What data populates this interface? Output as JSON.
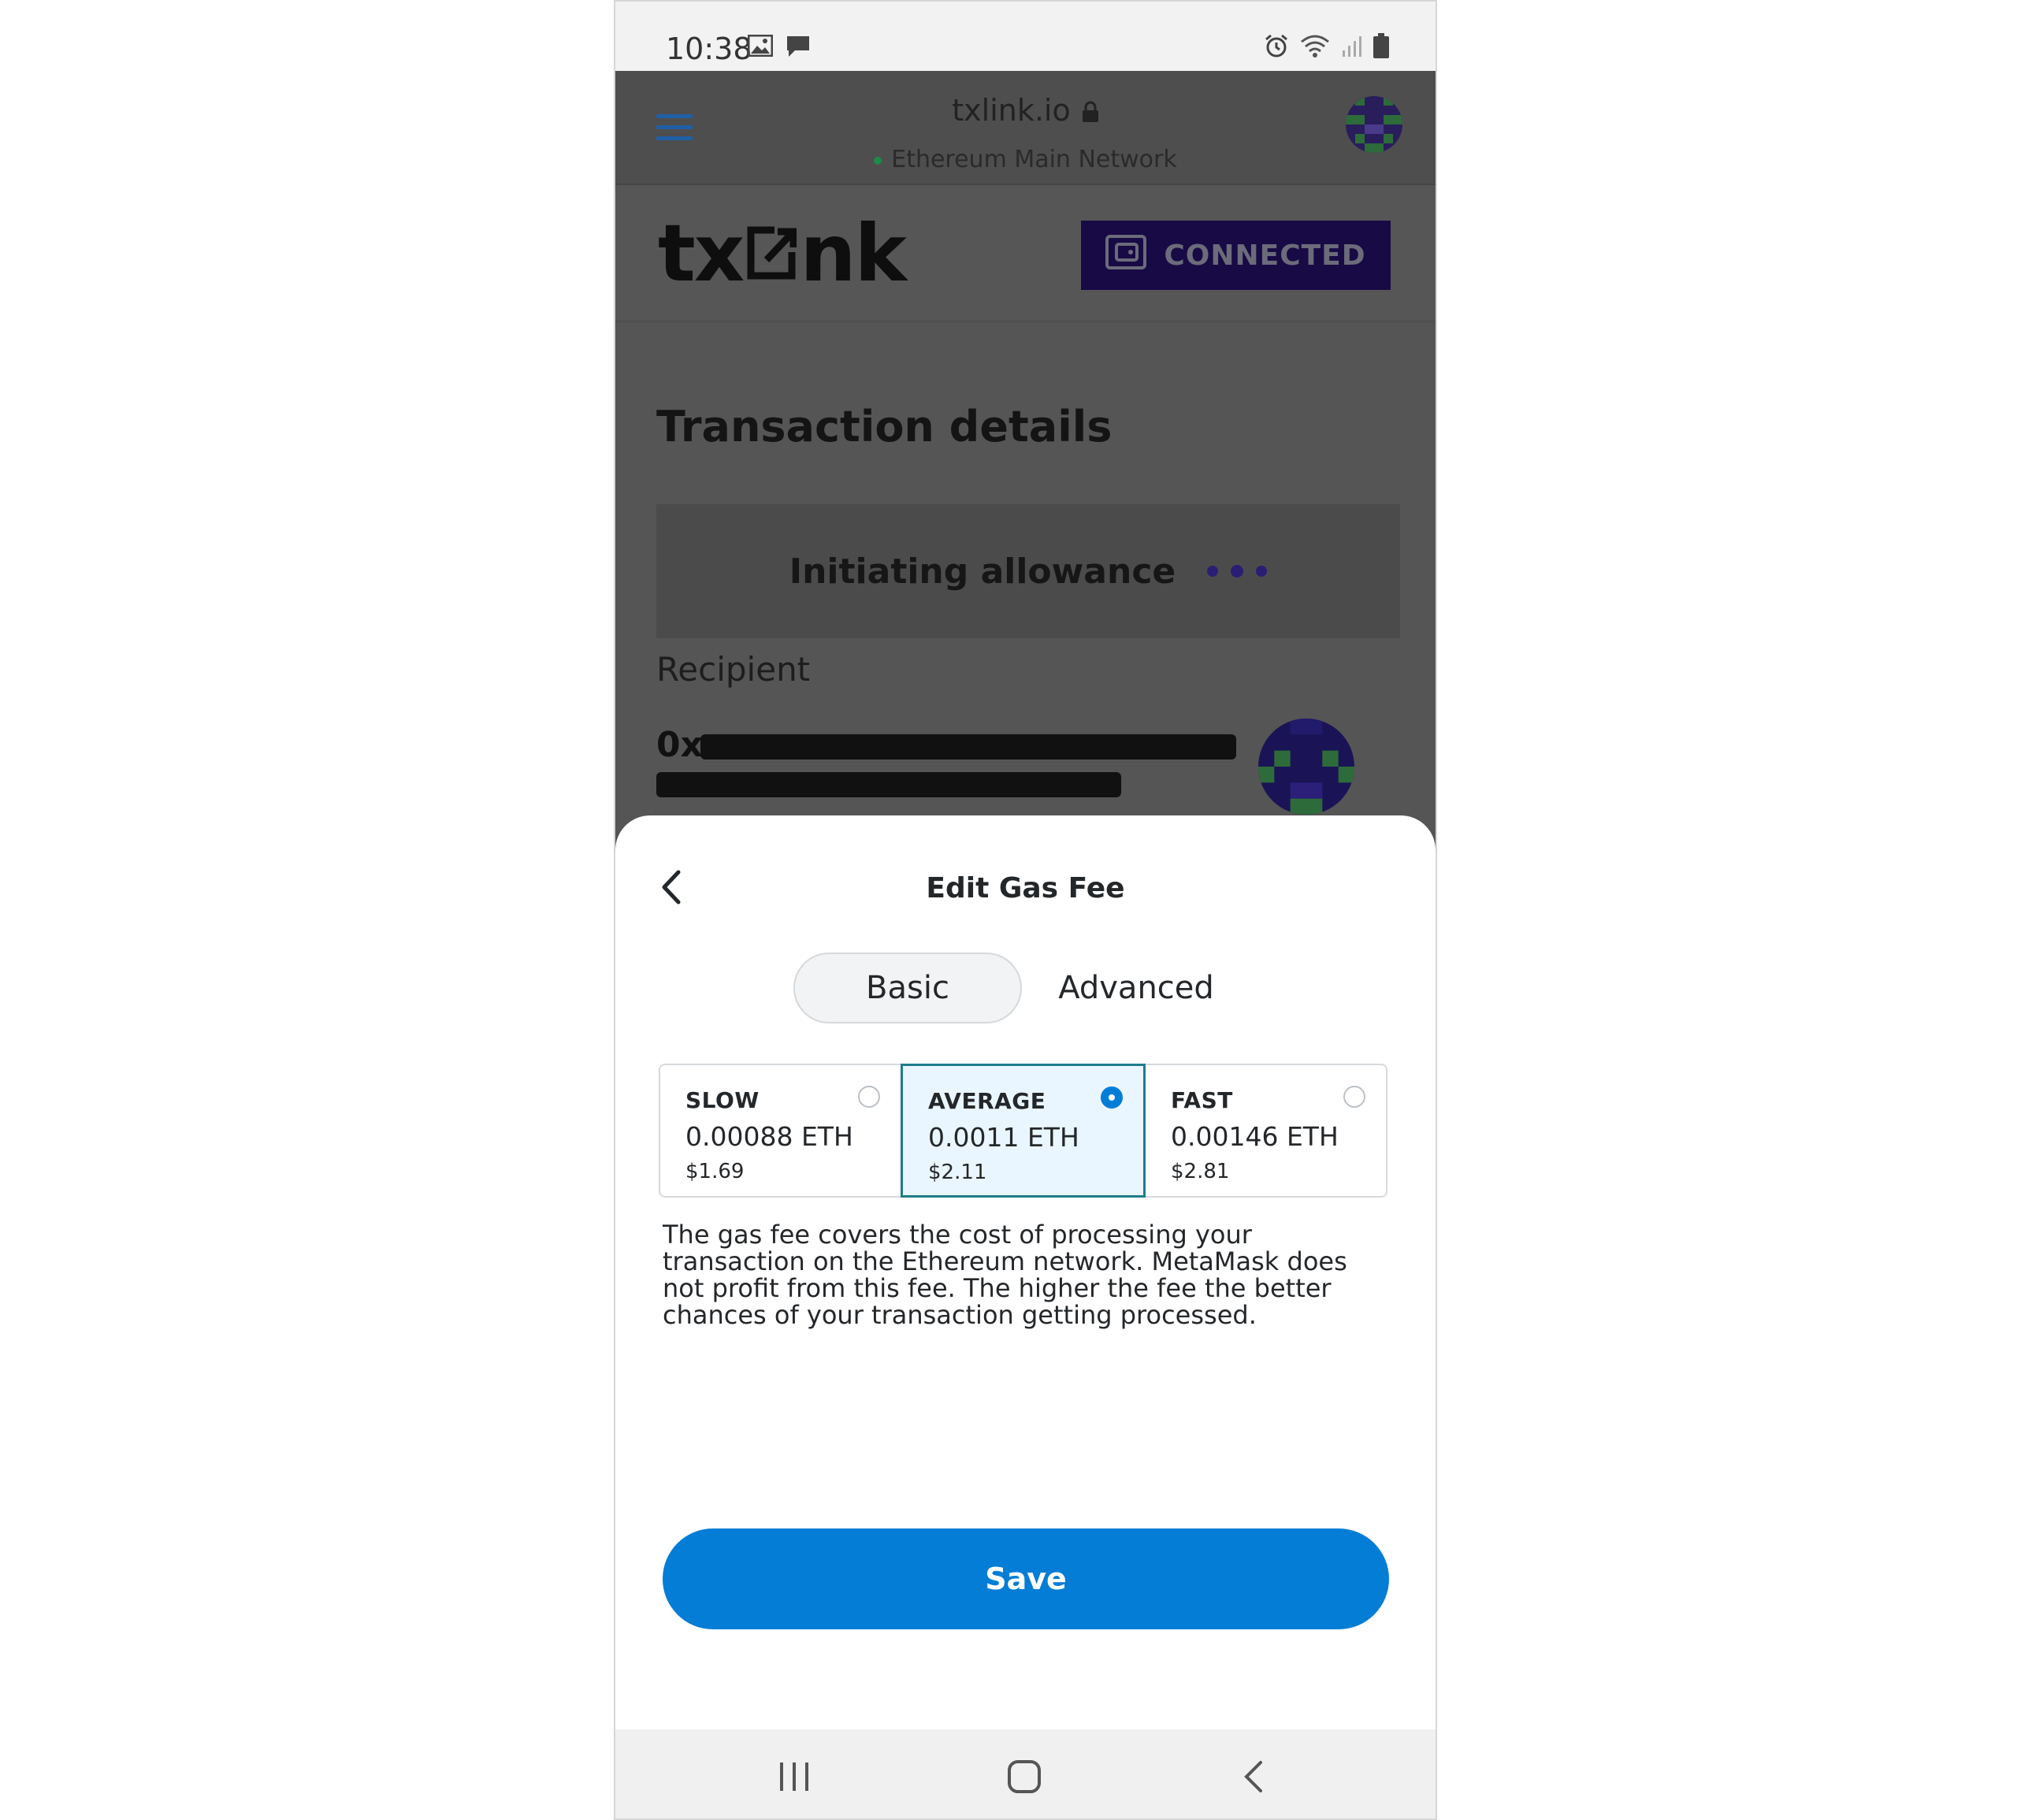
{
  "status_bar": {
    "time": "10:38",
    "left_icons": [
      "image-icon",
      "message-icon"
    ],
    "right_icons": [
      "alarm-icon",
      "wifi-icon",
      "signal-icon",
      "battery-icon"
    ]
  },
  "browser": {
    "url": "txlink.io",
    "network": "Ethereum Main Network",
    "network_dot_color": "#1e8a4a"
  },
  "site": {
    "logo_left": "tx",
    "logo_right": "nk",
    "connected_label": "CONNECTED",
    "connected_bg": "#180a45"
  },
  "transaction": {
    "title": "Transaction details",
    "status": "Initiating allowance",
    "recipient_label": "Recipient",
    "recipient_prefix": "0x"
  },
  "gas_sheet": {
    "title": "Edit Gas Fee",
    "tabs": [
      {
        "label": "Basic",
        "active": true
      },
      {
        "label": "Advanced",
        "active": false
      }
    ],
    "options": [
      {
        "name": "SLOW",
        "eth": "0.00088 ETH",
        "usd": "$1.69",
        "selected": false
      },
      {
        "name": "AVERAGE",
        "eth": "0.0011 ETH",
        "usd": "$2.11",
        "selected": true
      },
      {
        "name": "FAST",
        "eth": "0.00146 ETH",
        "usd": "$2.81",
        "selected": false
      }
    ],
    "description": "The gas fee covers the cost of processing your transaction on the Ethereum network. MetaMask does not profit from this fee. The higher the fee the better chances of your transaction getting processed.",
    "save_label": "Save",
    "accent_color": "#037dd6"
  },
  "nav_bar": {
    "icons": [
      "recent-apps-icon",
      "home-icon",
      "back-icon"
    ]
  }
}
